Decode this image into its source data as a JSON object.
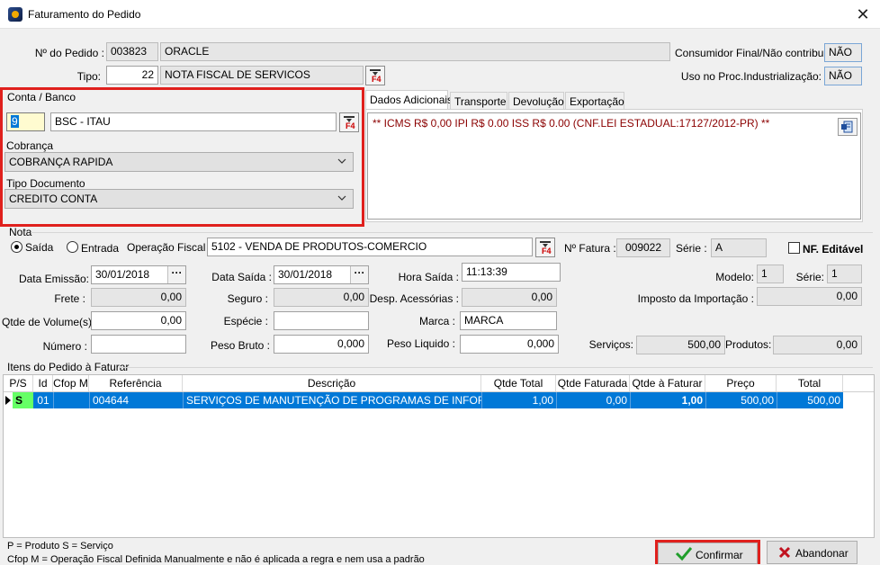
{
  "window": {
    "title": "Faturamento do Pedido"
  },
  "header": {
    "pedido_label": "Nº do Pedido :",
    "pedido_num": "003823",
    "pedido_nome": "ORACLE",
    "tipo_label": "Tipo:",
    "tipo_code": "22",
    "tipo_desc": "NOTA FISCAL DE SERVICOS",
    "consumidor_label": "Consumidor Final/Não contribuinte:",
    "consumidor_value": "NÃO",
    "proc_label": "Uso no Proc.Industrialização:",
    "proc_value": "NÃO"
  },
  "conta": {
    "group_label": "Conta / Banco",
    "code": "9",
    "name": "BSC - ITAU",
    "cobranca_label": "Cobrança",
    "cobranca_value": "COBRANÇA RAPIDA",
    "tipo_doc_label": "Tipo Documento",
    "tipo_doc_value": "CREDITO CONTA"
  },
  "tabs": [
    "Dados Adicionais",
    "Transporte",
    "Devolução",
    "Exportação"
  ],
  "dados_adicionais": "** ICMS R$ 0,00 IPI R$ 0.00 ISS R$ 0.00 (CNF.LEI ESTADUAL:17127/2012-PR) **",
  "nota": {
    "group_label": "Nota",
    "saida_label": "Saída",
    "entrada_label": "Entrada",
    "operacao_label": "Operação Fiscal :",
    "operacao_value": "5102 - VENDA DE PRODUTOS-COMERCIO",
    "fatura_label": "Nº Fatura :",
    "fatura_value": "009022",
    "serie_label": "Série :",
    "serie_value": "A",
    "nf_editavel_label": "NF. Editável",
    "data_emissao_label": "Data Emissão:",
    "data_emissao": "30/01/2018",
    "data_saida_label": "Data Saída :",
    "data_saida": "30/01/2018",
    "hora_saida_label": "Hora Saída :",
    "hora_saida": "11:13:39",
    "modelo_label": "Modelo:",
    "modelo_value": "1",
    "serie2_label": "Série:",
    "serie2_value": "1",
    "frete_label": "Frete :",
    "frete_value": "0,00",
    "seguro_label": "Seguro :",
    "seguro_value": "0,00",
    "desp_label": "Desp. Acessórias :",
    "desp_value": "0,00",
    "imposto_label": "Imposto da Importação :",
    "imposto_value": "0,00",
    "qtde_vol_label": "Qtde de Volume(s) :",
    "qtde_vol_value": "0,00",
    "especie_label": "Espécie :",
    "especie_value": "",
    "marca_label": "Marca :",
    "marca_value": "MARCA",
    "numero_label": "Número :",
    "numero_value": "",
    "peso_bruto_label": "Peso Bruto :",
    "peso_bruto_value": "0,000",
    "peso_liquido_label": "Peso Liquido :",
    "peso_liquido_value": "0,000",
    "servicos_label": "Serviços:",
    "servicos_value": "500,00",
    "produtos_label": "Produtos:",
    "produtos_value": "0,00"
  },
  "itens": {
    "group_label": "Itens do Pedido à Faturar",
    "columns": [
      "P/S",
      "Id",
      "Cfop M",
      "Referência",
      "Descrição",
      "Qtde Total",
      "Qtde Faturada",
      "Qtde à Faturar",
      "Preço",
      "Total"
    ],
    "rows": [
      [
        "S",
        "01",
        "",
        "004644",
        "SERVIÇOS DE MANUTENÇÃO DE PROGRAMAS DE INFORMATICA",
        "1,00",
        "0,00",
        "1,00",
        "500,00",
        "500,00"
      ]
    ]
  },
  "footer": {
    "legend1": "P = Produto S = Serviço",
    "legend2": "Cfop M = Operação Fiscal Definida Manualmente e não é aplicada a regra e nem usa a padrão",
    "confirm_label": "Confirmar",
    "cancel_label": "Abandonar"
  },
  "colors": {
    "highlight_red": "#e0201d",
    "selection_blue": "#0078d7",
    "note_text": "#8b0000",
    "ps_green": "#66ff66"
  }
}
